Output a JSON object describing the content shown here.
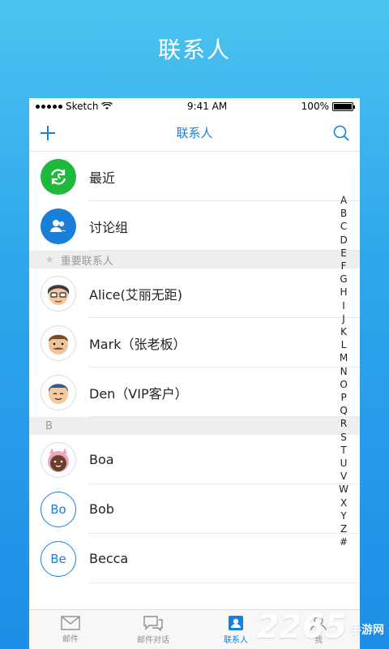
{
  "banner": {
    "title": "联系人"
  },
  "status": {
    "carrier": "Sketch",
    "time": "9:41 AM",
    "battery": "100%"
  },
  "nav": {
    "title": "联系人"
  },
  "fixed_rows": [
    {
      "label": "最近"
    },
    {
      "label": "讨论组"
    }
  ],
  "section_starred": {
    "label": "重要联系人"
  },
  "starred": [
    {
      "label": "Alice(艾丽无距)"
    },
    {
      "label": "Mark（张老板）"
    },
    {
      "label": "Den（VIP客户）"
    }
  ],
  "section_b": {
    "label": "B"
  },
  "b_contacts": [
    {
      "label": "Boa",
      "initials": ""
    },
    {
      "label": "Bob",
      "initials": "Bo"
    },
    {
      "label": "Becca",
      "initials": "Be"
    }
  ],
  "index_letters": [
    "A",
    "B",
    "C",
    "D",
    "E",
    "F",
    "G",
    "H",
    "I",
    "J",
    "K",
    "L",
    "M",
    "N",
    "O",
    "P",
    "Q",
    "R",
    "S",
    "T",
    "U",
    "V",
    "W",
    "X",
    "Y",
    "Z",
    "#"
  ],
  "tabs": [
    {
      "label": "邮件"
    },
    {
      "label": "邮件对话"
    },
    {
      "label": "联系人"
    },
    {
      "label": "我"
    }
  ],
  "watermark": {
    "number": "2265",
    "site": "手游网"
  },
  "colors": {
    "accent": "#1a7fd8",
    "recent_green": "#1eb83a",
    "group_blue": "#1a7fd8"
  }
}
